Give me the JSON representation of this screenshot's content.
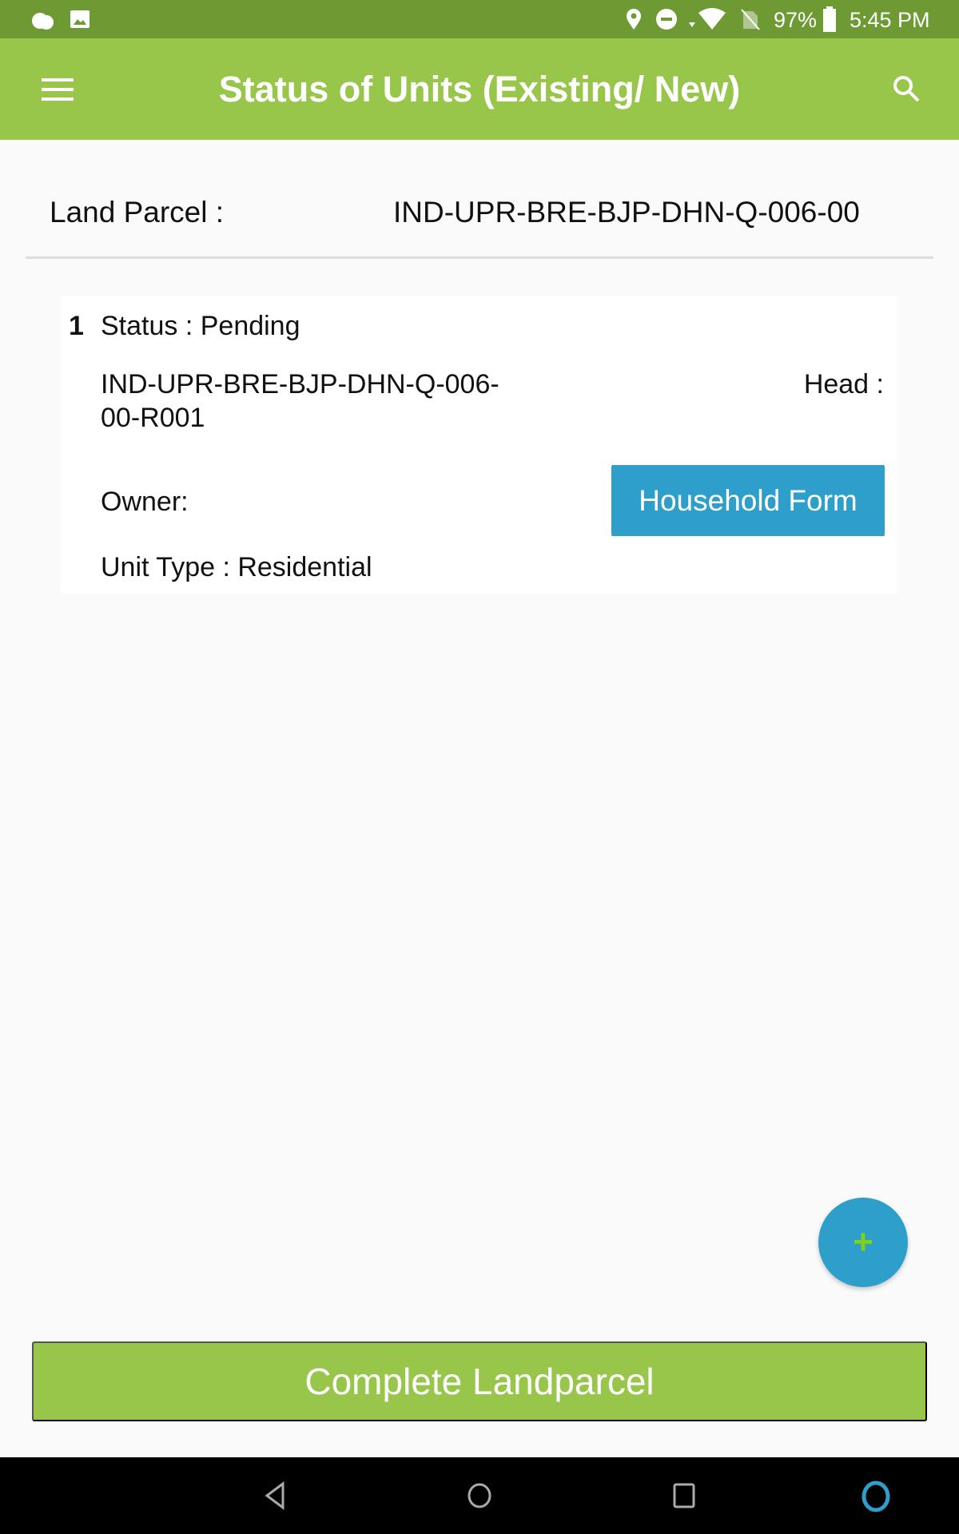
{
  "status_bar": {
    "battery": "97%",
    "time": "5:45 PM",
    "icons": [
      "weather-icon",
      "image-icon",
      "location-icon",
      "dnd-icon",
      "wifi-icon",
      "no-sim-icon",
      "battery-icon"
    ]
  },
  "app_bar": {
    "title": "Status of Units (Existing/ New)",
    "menu_icon": "menu-icon",
    "search_icon": "search-icon"
  },
  "land_parcel": {
    "label": "Land Parcel :",
    "value": "IND-UPR-BRE-BJP-DHN-Q-006-00"
  },
  "units": [
    {
      "index": "1",
      "status": "Status : Pending",
      "id_line1": "IND-UPR-BRE-BJP-DHN-Q-006-",
      "id_line2": "00-R001",
      "head": "Head :",
      "owner": "Owner:",
      "unit_type": "Unit Type : Residential",
      "button": "Household Form"
    }
  ],
  "fab": {
    "label": "+"
  },
  "complete_button": "Complete Landparcel",
  "colors": {
    "status_bar": "#6e9a34",
    "app_bar": "#97c64b",
    "accent_blue": "#2e9fca"
  }
}
